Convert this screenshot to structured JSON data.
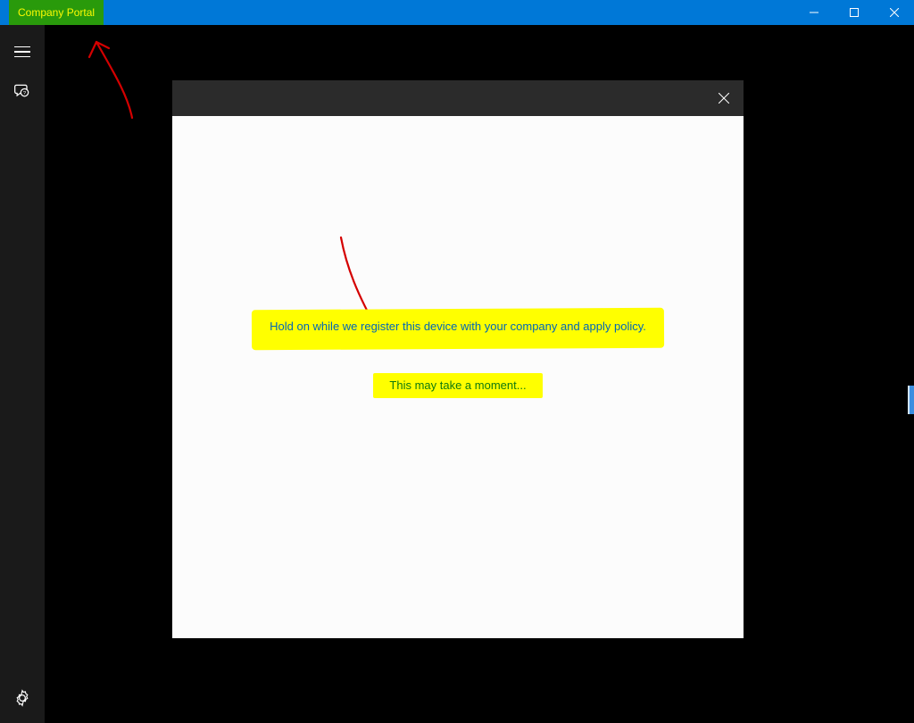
{
  "titlebar": {
    "app_title": "Company Portal"
  },
  "dialog": {
    "message_line_1": "Hold on while we register this device with your company and apply policy.",
    "message_line_2": "This may take a moment..."
  },
  "colors": {
    "titlebar_bg": "#0078d7",
    "title_highlight_bg": "#299a0b",
    "title_highlight_text": "#fbfb02",
    "highlight": "#ffff00",
    "annotation": "#d40000"
  }
}
